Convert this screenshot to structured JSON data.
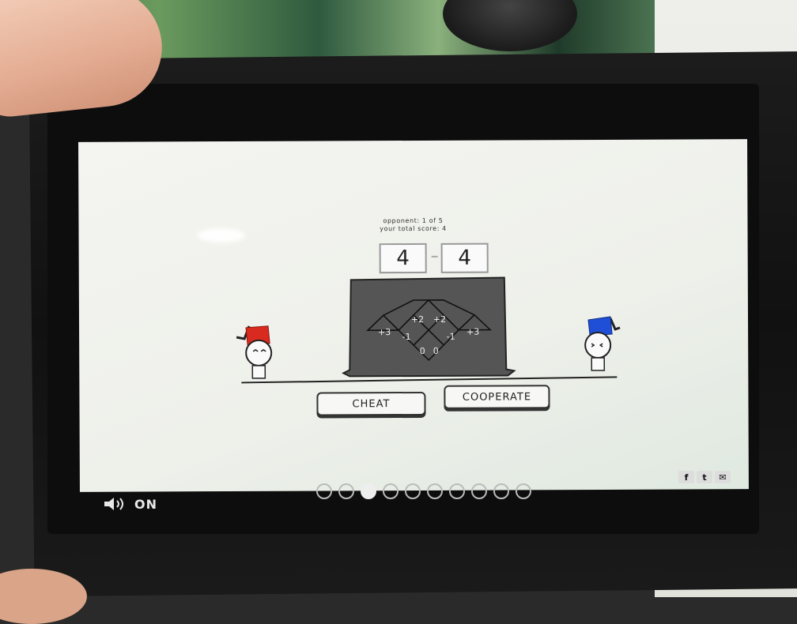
{
  "header": {
    "opponent_text": "opponent: 1 of 5",
    "score_text": "your total score: 4"
  },
  "scores": {
    "left": "4",
    "right": "4"
  },
  "payoff_board": {
    "cells": [
      "+2",
      "+2",
      "+3",
      "-1",
      "-1",
      "+3",
      "0",
      "0"
    ]
  },
  "buttons": {
    "cheat": "CHEAT",
    "cooperate": "COOPERATE"
  },
  "sound": {
    "label": "ON",
    "icon": "speaker-icon"
  },
  "pagination": {
    "total": 10,
    "active_index": 2
  },
  "share": {
    "facebook": "f",
    "twitter": "t",
    "email": "✉"
  },
  "colors": {
    "player_hat": "#d82a1e",
    "opponent_hat": "#1f4fd6",
    "board": "#555555"
  }
}
